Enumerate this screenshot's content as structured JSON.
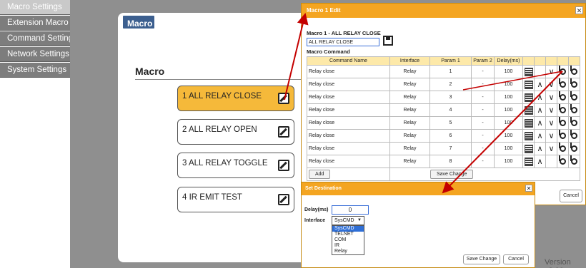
{
  "sidebar": {
    "items": [
      {
        "label": "Macro Settings"
      },
      {
        "label": "Extension Macro"
      },
      {
        "label": "Command Settings"
      },
      {
        "label": "Network Settings"
      },
      {
        "label": "System Settings"
      }
    ]
  },
  "panel": {
    "tab": "Macro",
    "heading": "Macro",
    "macros": [
      {
        "label": "1 ALL RELAY CLOSE"
      },
      {
        "label": "2 ALL RELAY OPEN"
      },
      {
        "label": "3 ALL RELAY TOGGLE"
      },
      {
        "label": "4 IR EMIT TEST"
      }
    ]
  },
  "edit_dialog": {
    "title": "Macro 1 Edit",
    "macro_title": "Macro 1 - ALL RELAY CLOSE",
    "name_value": "ALL RELAY CLOSE",
    "command_label": "Macro Command",
    "columns": [
      "Command Name",
      "Interface",
      "Param 1",
      "Param 2",
      "Delay(ms)"
    ],
    "rows": [
      {
        "name": "Relay close",
        "iface": "Relay",
        "p1": "1",
        "p2": "-",
        "delay": "100"
      },
      {
        "name": "Relay close",
        "iface": "Relay",
        "p1": "2",
        "p2": "-",
        "delay": "100"
      },
      {
        "name": "Relay close",
        "iface": "Relay",
        "p1": "3",
        "p2": "-",
        "delay": "100"
      },
      {
        "name": "Relay close",
        "iface": "Relay",
        "p1": "4",
        "p2": "-",
        "delay": "100"
      },
      {
        "name": "Relay close",
        "iface": "Relay",
        "p1": "5",
        "p2": "-",
        "delay": "100"
      },
      {
        "name": "Relay close",
        "iface": "Relay",
        "p1": "6",
        "p2": "-",
        "delay": "100"
      },
      {
        "name": "Relay close",
        "iface": "Relay",
        "p1": "7",
        "p2": "-",
        "delay": "100"
      },
      {
        "name": "Relay close",
        "iface": "Relay",
        "p1": "8",
        "p2": "-",
        "delay": "100"
      }
    ],
    "add_label": "Add",
    "save_change_label": "Save Change",
    "cancel_label": "Cancel"
  },
  "dest_dialog": {
    "title": "Set Destination",
    "delay_label": "Delay(ms)",
    "delay_value": "0",
    "interface_label": "Interface",
    "interface_selected": "SysCMD",
    "interface_options": [
      "SysCMD",
      "TELNET",
      "COM",
      "IR",
      "Relay"
    ],
    "save_change_label": "Save Change",
    "cancel_label": "Cancel"
  },
  "version": "Version v2.00",
  "colors": {
    "accent": "#f4a521",
    "sidebar": "#7d7d7d",
    "tab": "#3c5f8f",
    "annotation": "#c40000"
  }
}
